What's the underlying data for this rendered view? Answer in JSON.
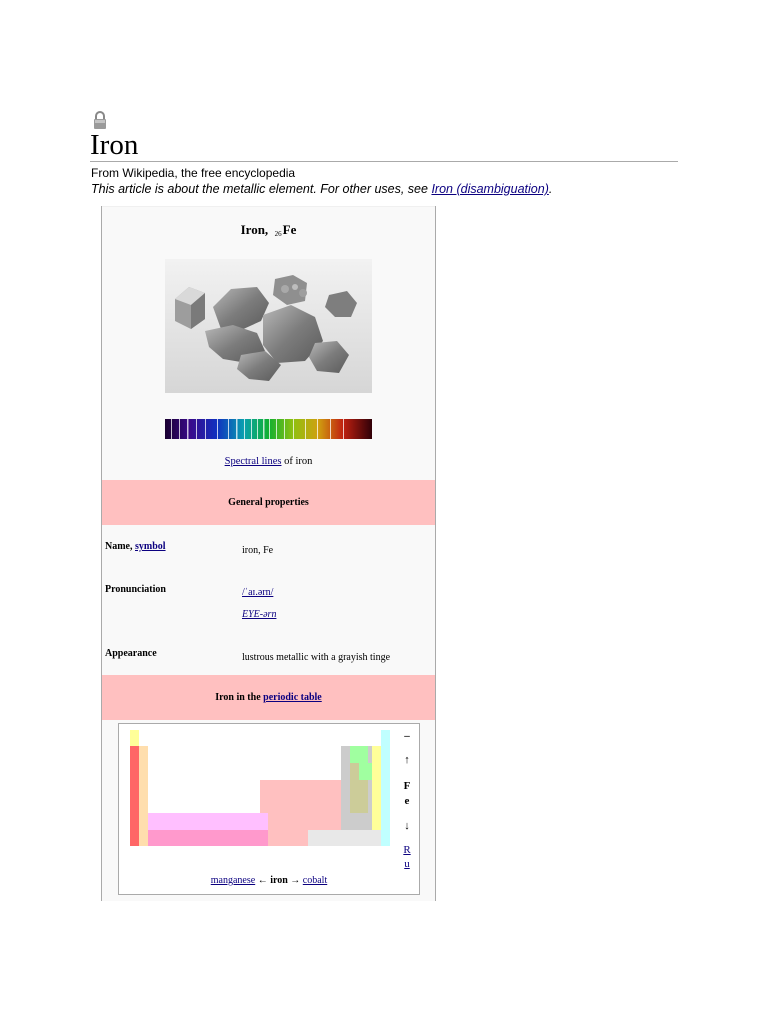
{
  "page": {
    "title": "Iron",
    "tagline": "From Wikipedia, the free encyclopedia",
    "hatnote_prefix": "This article is about the metallic element. For other uses, see ",
    "hatnote_link": "Iron (disambiguation)",
    "hatnote_suffix": "."
  },
  "infobox": {
    "title_name": "Iron,",
    "title_mass": "26",
    "title_symbol": "Fe",
    "spectral_link": "Spectral lines",
    "spectral_suffix": " of iron",
    "section_general": "General properties",
    "rows": {
      "name_label": "Name, ",
      "name_link": "symbol",
      "name_value": "iron, Fe",
      "pron_label": "Pronunciation",
      "pron_ipa": "/ˈaɪ.ərn/",
      "pron_resp": "EYE-ərn",
      "appearance_label": "Appearance",
      "appearance_value": "lustrous metallic with a grayish tinge"
    },
    "section_periodic_prefix": "Iron in the ",
    "section_periodic_link": "periodic table",
    "periodic": {
      "above": "–",
      "up_arrow": "↑",
      "symbol_1": "F",
      "symbol_2": "e",
      "down_arrow": "↓",
      "below_1": "R",
      "below_2": "u",
      "prev": "manganese",
      "left_arrow": " ← ",
      "current": "iron",
      "right_arrow": " → ",
      "next": "cobalt"
    }
  },
  "colors": {
    "section_band": "#ffc0c0",
    "link": "#0b0080",
    "alkali": "#ff6666",
    "alkaline_earth": "#ffdead",
    "transition": "#ffc0c0",
    "lanthanide": "#ffbfff",
    "actinide": "#ff99cc",
    "metalloid": "#cccc99",
    "nonmetal": "#a0ffa0",
    "halogen": "#ffff99",
    "noble_gas": "#c0ffff",
    "poor_metal": "#cccccc"
  }
}
